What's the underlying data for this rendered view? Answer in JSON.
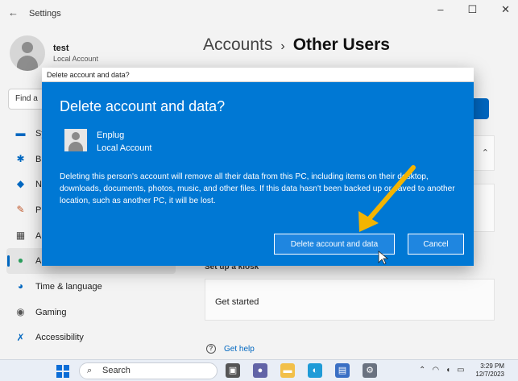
{
  "settings": {
    "app_title": "Settings",
    "profile": {
      "name": "test",
      "type": "Local Account"
    },
    "find_placeholder": "Find a",
    "nav_items": [
      {
        "label": "Sy",
        "icon": "system-icon",
        "active": false
      },
      {
        "label": "Bl",
        "icon": "bluetooth-icon",
        "active": false
      },
      {
        "label": "N",
        "icon": "network-icon",
        "active": false
      },
      {
        "label": "P",
        "icon": "personalization-icon",
        "active": false
      },
      {
        "label": "A",
        "icon": "apps-icon",
        "active": false
      },
      {
        "label": "A",
        "icon": "accounts-icon",
        "active": true
      },
      {
        "label": "Time & language",
        "icon": "globe-icon",
        "active": false
      },
      {
        "label": "Gaming",
        "icon": "gaming-icon",
        "active": false
      },
      {
        "label": "Accessibility",
        "icon": "accessibility-icon",
        "active": false
      }
    ],
    "breadcrumb": {
      "parent": "Accounts",
      "separator": "›",
      "current": "Other Users"
    },
    "setup_label": "Set up a kiosk",
    "get_started": "Get started",
    "get_help": "Get help"
  },
  "dialog": {
    "window_title": "Delete account and data?",
    "heading": "Delete account and data?",
    "account_name": "Enplug",
    "account_type": "Local Account",
    "body": "Deleting this person's account will remove all their data from this PC, including items on their desktop, downloads, documents, photos, music, and other files. If this data hasn't been backed up or saved to another location, such as another PC, it will be lost.",
    "primary_button": "Delete account and data",
    "cancel_button": "Cancel"
  },
  "taskbar": {
    "search_label": "Search",
    "time": "3:29 PM",
    "date": "12/7/2023"
  },
  "colors": {
    "dialog_bg": "#0078d4",
    "accent": "#0067c0",
    "arrow": "#f4b400"
  }
}
